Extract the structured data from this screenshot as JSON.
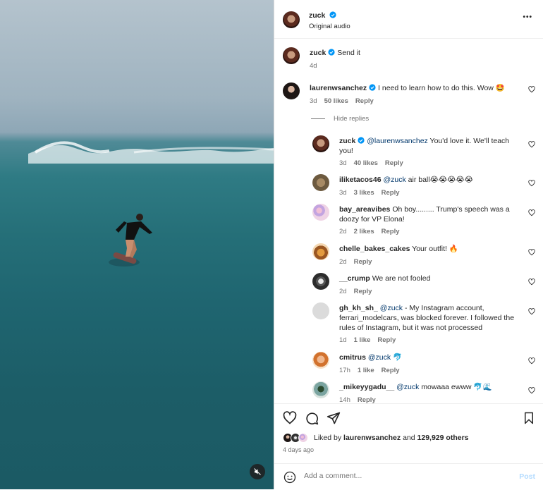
{
  "header": {
    "username": "zuck",
    "subtitle": "Original audio",
    "more": "•••"
  },
  "caption": {
    "username": "zuck",
    "text": "Send it",
    "time": "4d"
  },
  "comments": [
    {
      "username": "laurenwsanchez",
      "text": "I need to learn how to do this. Wow 🤩",
      "time": "3d",
      "likes": "50 likes",
      "reply": "Reply"
    }
  ],
  "hide_replies": "Hide replies",
  "replies": [
    {
      "username": "zuck",
      "mention": "@laurenwsanchez",
      "text": "You'd love it. We'll teach you!",
      "time": "3d",
      "likes": "40 likes",
      "reply": "Reply"
    },
    {
      "username": "iliketacos46",
      "mention": "@zuck",
      "text": "air ball😭😭😭😭😭",
      "time": "3d",
      "likes": "3 likes",
      "reply": "Reply"
    },
    {
      "username": "bay_areavibes",
      "mention": "",
      "text": "Oh boy......... Trump's speech was a doozy for VP Elona!",
      "time": "2d",
      "likes": "2 likes",
      "reply": "Reply"
    },
    {
      "username": "chelle_bakes_cakes",
      "mention": "",
      "text": "Your outfit! 🔥",
      "time": "2d",
      "likes": "",
      "reply": "Reply"
    },
    {
      "username": "__crump",
      "mention": "",
      "text": "We are not fooled",
      "time": "2d",
      "likes": "",
      "reply": "Reply"
    },
    {
      "username": "gh_kh_sh_",
      "mention": "@zuck",
      "text": "- My Instagram account, ferrari_modelcars, was blocked forever. I followed the rules of Instagram, but it was not processed",
      "time": "1d",
      "likes": "1 like",
      "reply": "Reply"
    },
    {
      "username": "cmitrus",
      "mention": "@zuck",
      "text": "🐬",
      "time": "17h",
      "likes": "1 like",
      "reply": "Reply"
    },
    {
      "username": "_mikeyygadu__",
      "mention": "@zuck",
      "text": "mowaaa ewww 🐬🌊",
      "time": "14h",
      "likes": "",
      "reply": "Reply"
    }
  ],
  "likes": {
    "prefix": "Liked by",
    "user": "laurenwsanchez",
    "and": "and",
    "count": "129,929 others"
  },
  "posted": "4 days ago",
  "add_comment": {
    "placeholder": "Add a comment...",
    "post_label": "Post"
  }
}
